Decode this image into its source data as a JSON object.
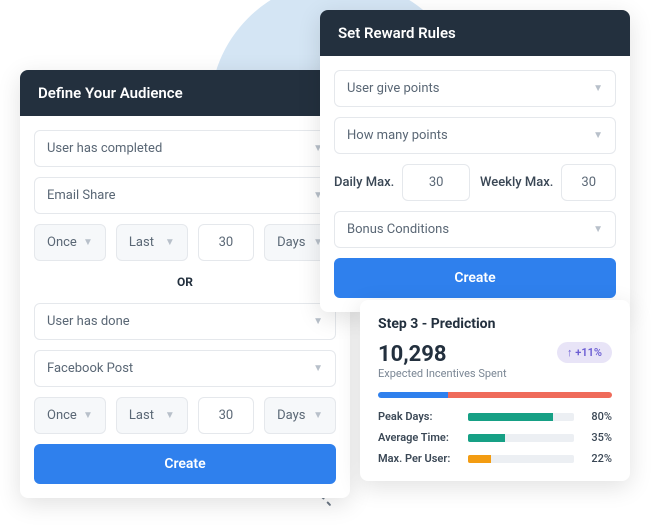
{
  "audience": {
    "title": "Define Your Audience",
    "group1": {
      "condition": "User has completed",
      "action": "Email Share",
      "frequency": "Once",
      "period": "Last",
      "count": "30",
      "unit": "Days"
    },
    "separator": "OR",
    "group2": {
      "condition": "User has done",
      "action": "Facebook Post",
      "frequency": "Once",
      "period": "Last",
      "count": "30",
      "unit": "Days"
    },
    "create_label": "Create"
  },
  "rewards": {
    "title": "Set Reward Rules",
    "give": "User give points",
    "how_many": "How many points",
    "daily_label": "Daily Max.",
    "daily_value": "30",
    "weekly_label": "Weekly Max.",
    "weekly_value": "30",
    "bonus": "Bonus Conditions",
    "create_label": "Create"
  },
  "prediction": {
    "title": "Step 3 - Prediction",
    "value": "10,298",
    "subtitle": "Expected Incentives Spent",
    "badge": "↑ +11%",
    "metrics": [
      {
        "label": "Peak Days:",
        "percent": 80,
        "display": "80%",
        "color": "#16a085"
      },
      {
        "label": "Average Time:",
        "percent": 35,
        "display": "35%",
        "color": "#16a085"
      },
      {
        "label": "Max. Per User:",
        "percent": 22,
        "display": "22%",
        "color": "#f39c12"
      }
    ]
  }
}
